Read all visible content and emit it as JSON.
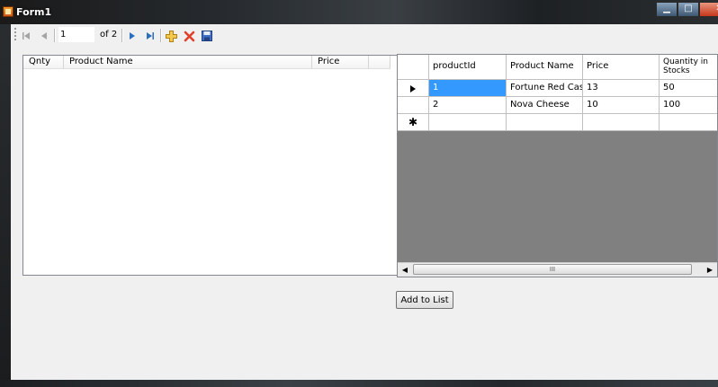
{
  "window": {
    "title": "Form1"
  },
  "toolbar": {
    "position_value": "1",
    "of_label": "of 2"
  },
  "list": {
    "columns": [
      "Qnty",
      "Product Name",
      "Price"
    ]
  },
  "grid": {
    "columns": [
      "productId",
      "Product Name",
      "Price",
      "Quantity in Stocks"
    ],
    "rows": [
      [
        "1",
        "Fortune Red Case",
        "13",
        "50"
      ],
      [
        "2",
        "Nova Cheese",
        "10",
        "100"
      ]
    ],
    "new_row_marker": "✱",
    "scroll_grip": "III"
  },
  "actions": {
    "add_label": "Add to List"
  },
  "colors": {
    "selection": "#3399ff",
    "grid_background": "#808080",
    "client": "#f0f0f0"
  }
}
